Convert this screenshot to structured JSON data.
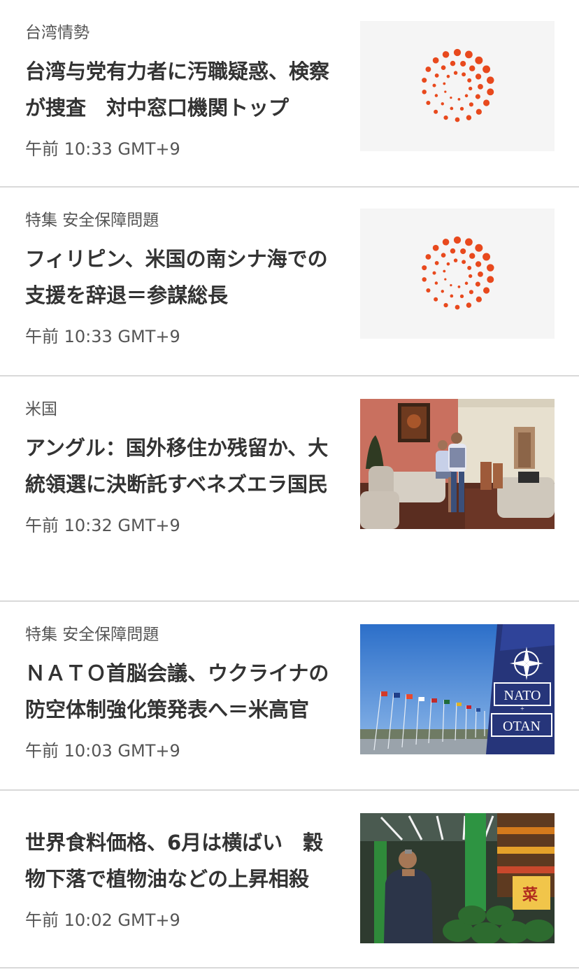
{
  "articles": [
    {
      "category": "台湾情勢",
      "headline": "台湾与党有力者に汚職疑惑、検察が捜査　対中窓口機関トップ",
      "timestamp": "午前 10:33 GMT+9",
      "thumbnail": "reuters-logo-placeholder"
    },
    {
      "category": "特集 安全保障問題",
      "headline": "フィリピン、米国の南シナ海での支援を辞退＝参謀総長",
      "timestamp": "午前 10:33 GMT+9",
      "thumbnail": "reuters-logo-placeholder"
    },
    {
      "category": "米国",
      "headline": "アングル：国外移住か残留か、大統領選に決断託すベネズエラ国民",
      "timestamp": "午前 10:32 GMT+9",
      "thumbnail": "couple-in-living-room-photo"
    },
    {
      "category": "特集 安全保障問題",
      "headline": "ＮＡＴＯ首脳会議、ウクライナの防空体制強化策発表へ＝米高官",
      "timestamp": "午前 10:03 GMT+9",
      "thumbnail": "nato-banner-flags-photo",
      "banner_text": [
        "NATO",
        "OTAN"
      ]
    },
    {
      "category": "",
      "headline": "世界食料価格、6月は横ばい　穀物下落で植物油などの上昇相殺",
      "timestamp": "午前 10:02 GMT+9",
      "thumbnail": "market-vendor-watermelons-photo",
      "sign_text": "菜"
    }
  ],
  "colors": {
    "logo_orange": "#e8491d",
    "divider": "#d9d9d9",
    "thumb_placeholder_bg": "#f5f5f5"
  }
}
